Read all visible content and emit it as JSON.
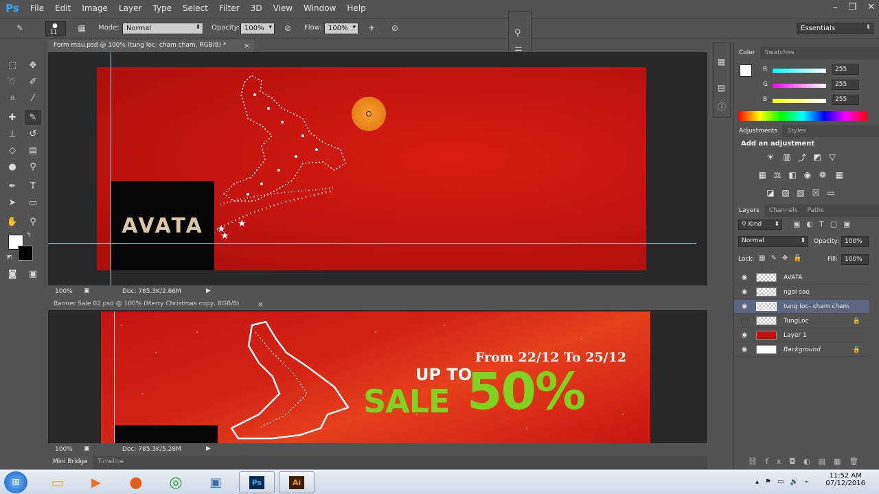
{
  "app": {
    "logo": "Ps"
  },
  "menu": [
    "File",
    "Edit",
    "Image",
    "Layer",
    "Type",
    "Select",
    "Filter",
    "3D",
    "View",
    "Window",
    "Help"
  ],
  "window_controls": {
    "minimize": "–",
    "restore": "❐",
    "close": "✕"
  },
  "options": {
    "brush_size": "11",
    "mode_label": "Mode:",
    "mode_value": "Normal",
    "opacity_label": "Opacity:",
    "opacity_value": "100%",
    "flow_label": "Flow:",
    "flow_value": "100%",
    "workspace": "Essentials"
  },
  "doc1": {
    "tab_title": "Form mau.psd @ 100% (tung loc- cham cham, RGB/8) *",
    "close": "×",
    "zoom": "100%",
    "doc_info": "Doc: 785.3K/2.66M",
    "avata_text": "AVATA"
  },
  "doc2": {
    "tab_title": "Banner Sale 02.psd @ 100% (Merry Christmas copy, RGB/8)",
    "close": "×",
    "zoom": "100%",
    "doc_info": "Doc: 785.3K/5.28M",
    "date_text": "From 22/12 To 25/12",
    "upto_text": "UP TO",
    "sale_text": "SALE",
    "percent_text": "50%"
  },
  "bottom_tabs": [
    "Mini Bridge",
    "Timeline"
  ],
  "color_panel": {
    "tabs": [
      "Color",
      "Swatches"
    ],
    "channels": [
      {
        "label": "R",
        "value": "255"
      },
      {
        "label": "G",
        "value": "255"
      },
      {
        "label": "B",
        "value": "255"
      }
    ]
  },
  "adjustments_panel": {
    "tabs": [
      "Adjustments",
      "Styles"
    ],
    "heading": "Add an adjustment"
  },
  "layers_panel": {
    "tabs": [
      "Layers",
      "Channels",
      "Paths"
    ],
    "kind_label": "Kind",
    "blend_mode": "Normal",
    "opacity_label": "Opacity:",
    "opacity_value": "100%",
    "lock_label": "Lock:",
    "fill_label": "Fill:",
    "fill_value": "100%",
    "layers": [
      {
        "name": "AVATA",
        "visible": true,
        "selected": false
      },
      {
        "name": "ngoi sao",
        "visible": true,
        "selected": false
      },
      {
        "name": "tung loc- cham cham",
        "visible": true,
        "selected": true
      },
      {
        "name": "TungLoc",
        "visible": false,
        "selected": false
      },
      {
        "name": "Layer 1",
        "visible": true,
        "selected": false
      },
      {
        "name": "Background",
        "visible": true,
        "selected": false
      }
    ]
  },
  "taskbar": {
    "time": "11:52 AM",
    "date": "07/12/2016"
  },
  "colors": {
    "accent_ps": "#31a8ff",
    "banner_red": "#c81510",
    "sale_green": "#7ed321",
    "selected_layer": "#5c6680"
  }
}
